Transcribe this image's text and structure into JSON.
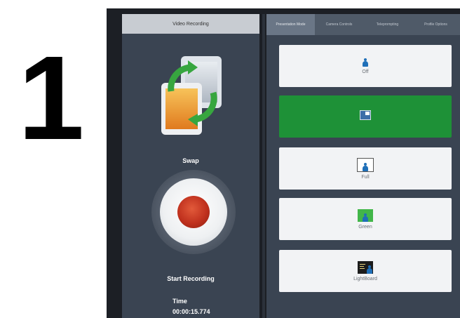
{
  "overlay": {
    "step_number": "1"
  },
  "left_panel": {
    "header": "Video Recording",
    "swap_label": "Swap",
    "start_label": "Start Recording",
    "time_label": "Time",
    "time_value": "00:00:15.774"
  },
  "tabs": [
    {
      "label": "Presentation Mode",
      "active": true
    },
    {
      "label": "Camera Controls",
      "active": false
    },
    {
      "label": "Teleprompting",
      "active": false
    },
    {
      "label": "Profile Options",
      "active": false
    }
  ],
  "modes": [
    {
      "label": "Off",
      "icon": "person-icon",
      "active": false
    },
    {
      "label": "",
      "icon": "picture-in-picture-icon",
      "active": true
    },
    {
      "label": "Full",
      "icon": "full-frame-icon",
      "active": false
    },
    {
      "label": "Green",
      "icon": "green-screen-icon",
      "active": false
    },
    {
      "label": "LightBoard",
      "icon": "lightboard-icon",
      "active": false
    }
  ],
  "colors": {
    "active_mode": "#1e9137",
    "panel": "#3a4452",
    "record": "#c0311e"
  }
}
